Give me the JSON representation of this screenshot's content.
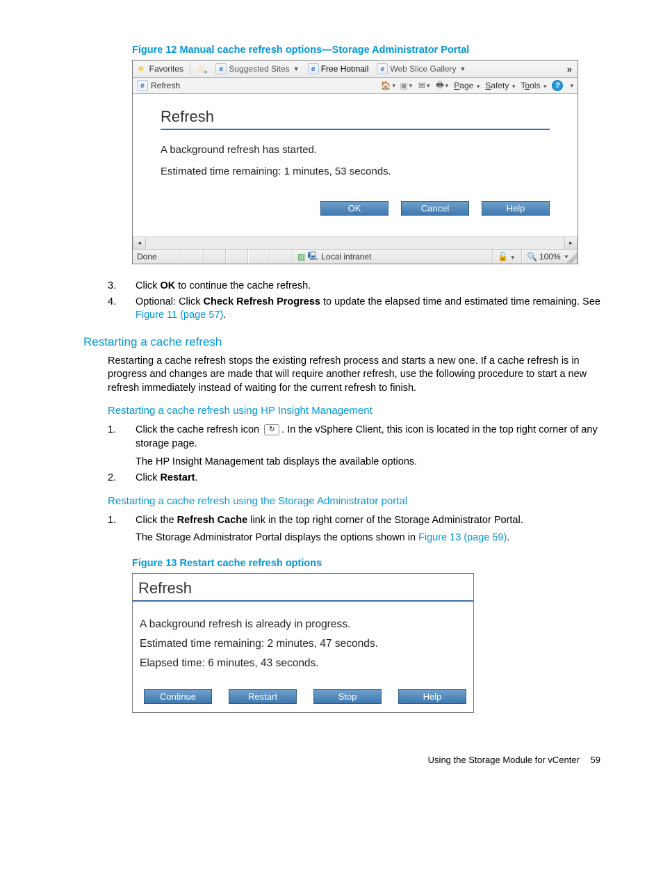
{
  "figure12": {
    "caption": "Figure 12 Manual cache refresh options—Storage Administrator Portal"
  },
  "ie": {
    "fav": {
      "label": "Favorites",
      "suggested": "Suggested Sites",
      "hotmail": "Free Hotmail",
      "webslice": "Web Slice Gallery"
    },
    "tab": "Refresh",
    "cmd": {
      "page": "Page",
      "safety": "Safety",
      "tools": "Tools"
    },
    "panel": {
      "title": "Refresh",
      "line1": "A background refresh has started.",
      "line2": "Estimated time remaining: 1 minutes, 53 seconds.",
      "ok": "OK",
      "cancel": "Cancel",
      "help": "Help"
    },
    "status": {
      "done": "Done",
      "zone": "Local intranet",
      "zoom": "100%"
    }
  },
  "step3": {
    "num": "3.",
    "pre": "Click ",
    "bold": "OK",
    "post": " to continue the cache refresh."
  },
  "step4": {
    "num": "4.",
    "pre": "Optional: Click ",
    "bold": "Check Refresh Progress",
    "post1": " to update the elapsed time and estimated time remaining. See ",
    "link": "Figure 11 (page 57)",
    "post2": "."
  },
  "h2": "Restarting a cache refresh",
  "para1": "Restarting a cache refresh stops the existing refresh process and starts a new one. If a cache refresh is in progress and changes are made that will require another refresh, use the following procedure to start a new refresh immediately instead of waiting for the current refresh to finish.",
  "h3a": "Restarting a cache refresh using HP Insight Management",
  "a1": {
    "num": "1.",
    "pre": "Click the cache refresh icon ",
    "post": ". In the vSphere Client, this icon is located in the top right corner of any storage page."
  },
  "a1b": "The HP Insight Management tab displays the available options.",
  "a2": {
    "num": "2.",
    "pre": "Click ",
    "bold": "Restart",
    "post": "."
  },
  "h3b": "Restarting a cache refresh using the Storage Administrator portal",
  "b1": {
    "num": "1.",
    "pre": "Click the ",
    "bold": "Refresh Cache",
    "post": " link in the top right corner of the Storage Administrator Portal."
  },
  "b1b": {
    "pre": "The Storage Administrator Portal displays the options shown in ",
    "link": "Figure 13 (page 59)",
    "post": "."
  },
  "figure13": {
    "caption": "Figure 13 Restart cache refresh options"
  },
  "rw": {
    "title": "Refresh",
    "l1": "A background refresh is already in progress.",
    "l2": "Estimated time remaining: 2 minutes, 47 seconds.",
    "l3": "Elapsed time: 6 minutes, 43 seconds.",
    "continue": "Continue",
    "restart": "Restart",
    "stop": "Stop",
    "help": "Help"
  },
  "footer": {
    "section": "Using the Storage Module for vCenter",
    "page": "59"
  }
}
